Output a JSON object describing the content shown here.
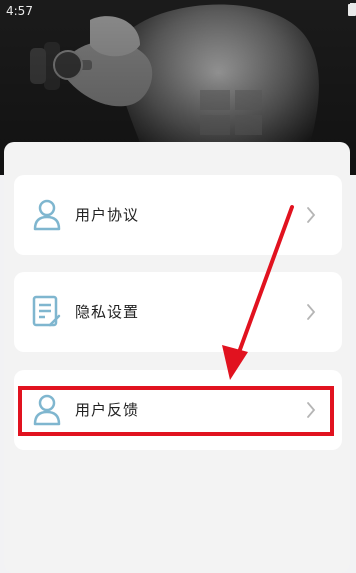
{
  "status": {
    "time": "4:57"
  },
  "menu": {
    "items": [
      {
        "label": "用户协议",
        "icon": "user-agreement-icon"
      },
      {
        "label": "隐私设置",
        "icon": "privacy-settings-icon"
      },
      {
        "label": "用户反馈",
        "icon": "user-feedback-icon"
      }
    ]
  },
  "colors": {
    "accent": "#7fb6cf",
    "highlight": "#e1121f"
  }
}
